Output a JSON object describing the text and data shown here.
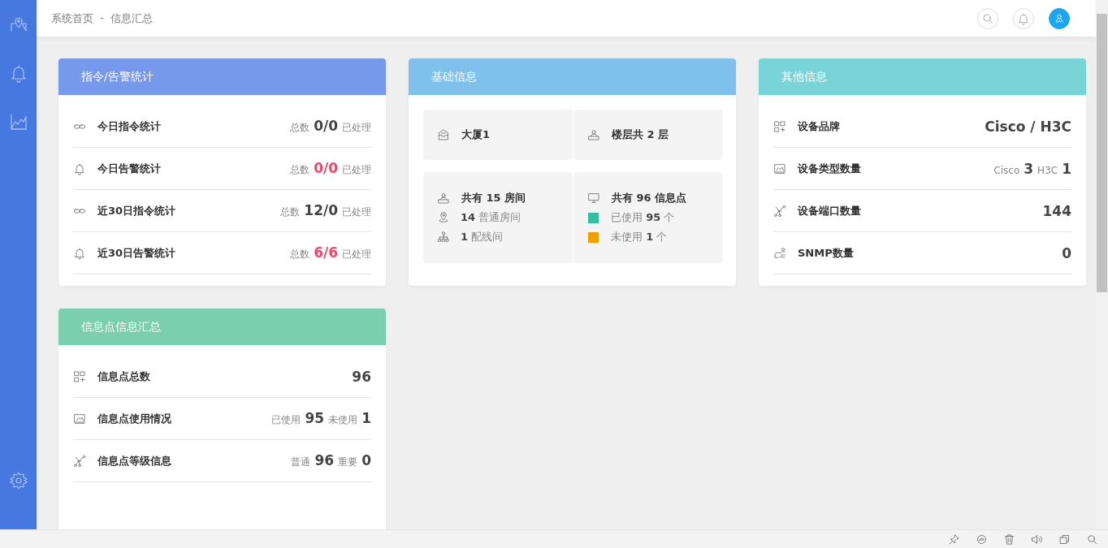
{
  "breadcrumb": {
    "items": [
      "系统首页",
      "信息汇总"
    ],
    "separator": "-"
  },
  "cards": [
    {
      "title": "指令/告警统计",
      "color": "#7699ec",
      "kind": "stats",
      "rows": [
        {
          "kind": "command",
          "label": "今日指令统计",
          "values": [
            {
              "text": "总数",
              "kind": "note"
            },
            {
              "text": "0/0",
              "kind": "num"
            },
            {
              "text": "已处理",
              "kind": "note"
            }
          ]
        },
        {
          "kind": "alarm",
          "label": "今日告警统计",
          "values": [
            {
              "text": "总数",
              "kind": "note"
            },
            {
              "text": "0/0",
              "kind": "alert"
            },
            {
              "text": "已处理",
              "kind": "note"
            }
          ]
        },
        {
          "kind": "command",
          "label": "近30日指令统计",
          "values": [
            {
              "text": "总数",
              "kind": "note"
            },
            {
              "text": "12/0",
              "kind": "num"
            },
            {
              "text": "已处理",
              "kind": "note"
            }
          ]
        },
        {
          "kind": "alarm",
          "label": "近30日告警统计",
          "values": [
            {
              "text": "总数",
              "kind": "note"
            },
            {
              "text": "6/6",
              "kind": "alert"
            },
            {
              "text": "已处理",
              "kind": "note"
            }
          ]
        }
      ]
    },
    {
      "title": "基础信息",
      "color": "#80c0ec",
      "kind": "blocks",
      "blocks": [
        {
          "kind": "building",
          "title": "大厦1"
        },
        {
          "kind": "floor",
          "title": "楼层共 2 层"
        },
        {
          "kind": "floor",
          "title": "共有 15 房间",
          "lines": [
            {
              "kind": "pin",
              "text": "**14** 普通房间"
            },
            {
              "kind": "network",
              "text": "**1** 配线间"
            }
          ]
        },
        {
          "kind": "monitor",
          "title": "共有 96 信息点",
          "lines": [
            {
              "kind": "swatch",
              "color": "#33bfa0",
              "text": "已使用 **95** 个"
            },
            {
              "kind": "swatch",
              "color": "#f0a000",
              "text": "未使用 **1** 个"
            }
          ]
        }
      ]
    },
    {
      "title": "其他信息",
      "color": "#79d4d8",
      "kind": "stats",
      "rows": [
        {
          "kind": "grid",
          "label": "设备品牌",
          "values": [
            {
              "text": "Cisco / H3C",
              "kind": "num"
            }
          ]
        },
        {
          "kind": "image",
          "label": "设备类型数量",
          "values": [
            {
              "text": "Cisco",
              "kind": "note"
            },
            {
              "text": "3",
              "kind": "num"
            },
            {
              "text": "H3C",
              "kind": "note"
            },
            {
              "text": "1",
              "kind": "num"
            }
          ]
        },
        {
          "kind": "nodes",
          "label": "设备端口数量",
          "values": [
            {
              "text": "144",
              "kind": "num"
            }
          ]
        },
        {
          "kind": "snmp",
          "label": "SNMP数量",
          "values": [
            {
              "text": "0",
              "kind": "num"
            }
          ]
        }
      ]
    },
    {
      "title": "信息点信息汇总",
      "color": "#7acfb0",
      "kind": "stats",
      "rows": [
        {
          "kind": "grid",
          "label": "信息点总数",
          "values": [
            {
              "text": "96",
              "kind": "num"
            }
          ]
        },
        {
          "kind": "image",
          "label": "信息点使用情况",
          "values": [
            {
              "text": "已使用",
              "kind": "note"
            },
            {
              "text": "95",
              "kind": "num"
            },
            {
              "text": "未使用",
              "kind": "note"
            },
            {
              "text": "1",
              "kind": "num"
            }
          ]
        },
        {
          "kind": "nodes",
          "label": "信息点等级信息",
          "values": [
            {
              "text": "普通",
              "kind": "note"
            },
            {
              "text": "96",
              "kind": "num"
            },
            {
              "text": "重要",
              "kind": "note"
            },
            {
              "text": "0",
              "kind": "num"
            }
          ]
        }
      ]
    }
  ]
}
